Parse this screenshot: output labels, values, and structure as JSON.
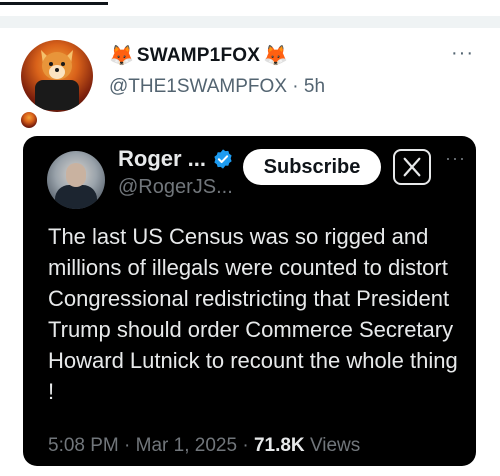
{
  "post": {
    "display_name": "SWAMP1FOX",
    "emoji": "🦊",
    "handle": "@THE1SWAMPFOX",
    "time": "5h",
    "separator": " · ",
    "more": "···"
  },
  "quoted": {
    "display_name": "Roger ...",
    "handle": "@RogerJS...",
    "subscribe_label": "Subscribe",
    "more": "···",
    "text": "The last US Census was so rigged and millions of illegals were counted to distort Congressional redistricting that President Trump should order Commerce Secretary Howard Lutnick to recount the whole thing !",
    "time": "5:08 PM",
    "date": "Mar 1, 2025",
    "views_count": "71.8K",
    "views_label": "Views",
    "separator": " · "
  },
  "colors": {
    "verified": "#1d9bf0",
    "accent_dark": "#000000"
  },
  "icons": [
    "avatar",
    "verified-badge-icon",
    "x-logo-icon",
    "more-icon"
  ]
}
